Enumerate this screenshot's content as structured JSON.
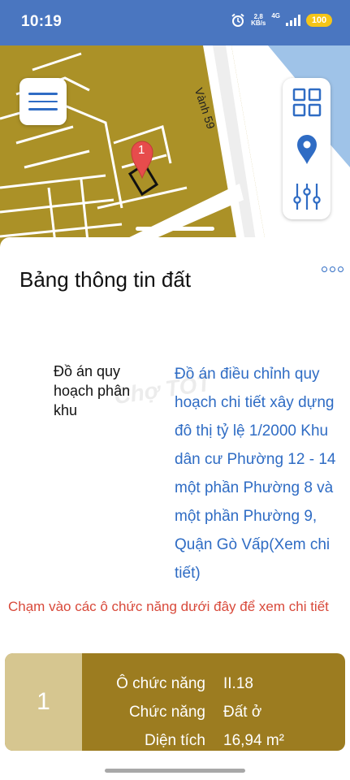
{
  "status": {
    "time": "10:19",
    "speed_value": "2,8",
    "speed_unit": "KB/s",
    "network": "4G",
    "battery": "100"
  },
  "map": {
    "road_label": "Vành 59",
    "marker_number": "1"
  },
  "sheet": {
    "title": "Bảng thông tin đất",
    "field": {
      "label": "Đồ án quy hoạch phân khu",
      "value": "Đồ án điều chỉnh quy hoạch chi tiết xây dựng đô thị tỷ lệ 1/2000 Khu dân cư Phường 12 - 14 một phần Phường 8 và một phần Phường 9, Quận Gò Vấp(Xem chi tiết)"
    },
    "watermark": "Chợ TỐT",
    "hint": "Chạm vào các ô chức năng dưới đây để xem chi tiết",
    "card": {
      "number": "1",
      "rows": [
        {
          "key": "Ô chức năng",
          "value": "II.18"
        },
        {
          "key": "Chức năng",
          "value": "Đất ở"
        },
        {
          "key": "Diện tích",
          "value": "16,94 m²"
        }
      ]
    }
  },
  "colors": {
    "status_bar": "#4a76c0",
    "map_land": "#ab9127",
    "accent": "#2f6cc4",
    "hint": "#d8493a",
    "card": "#9c7c20",
    "card_number": "#d6c690"
  }
}
